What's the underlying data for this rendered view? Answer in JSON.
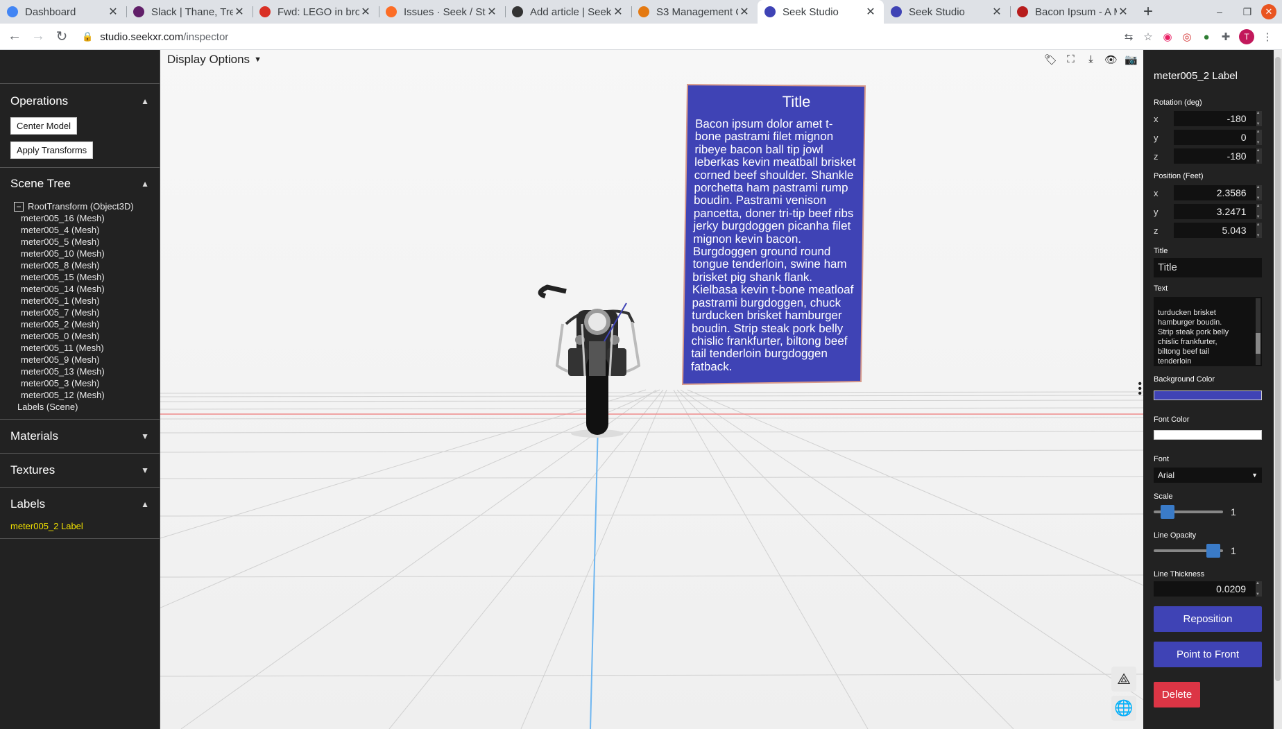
{
  "browser": {
    "tabs": [
      {
        "title": "Dashboard",
        "icon": "chrome-icon",
        "color": "#4285f4"
      },
      {
        "title": "Slack | Thane, Tre",
        "icon": "slack-icon",
        "color": "#611f69"
      },
      {
        "title": "Fwd: LEGO in bro",
        "icon": "gmail-icon",
        "color": "#d93025"
      },
      {
        "title": "Issues · Seek / Stu",
        "icon": "gitlab-icon",
        "color": "#fc6d26"
      },
      {
        "title": "Add article | Seek",
        "icon": "github-icon",
        "color": "#333333"
      },
      {
        "title": "S3 Management C",
        "icon": "aws-icon",
        "color": "#e47911"
      },
      {
        "title": "Seek Studio",
        "icon": "seek-icon",
        "color": "#3f43b5",
        "active": true
      },
      {
        "title": "Seek Studio",
        "icon": "seek-icon",
        "color": "#3f43b5"
      },
      {
        "title": "Bacon Ipsum - A M",
        "icon": "bacon-icon",
        "color": "#b71c1c"
      }
    ],
    "url_host": "studio.seekxr.com",
    "url_path": "/inspector",
    "avatar_letter": "T"
  },
  "left": {
    "operations": {
      "title": "Operations",
      "center_model": "Center Model",
      "apply_transforms": "Apply Transforms"
    },
    "scene_tree": {
      "title": "Scene Tree",
      "root": "RootTransform (Object3D)",
      "items": [
        "meter005_16 (Mesh)",
        "meter005_4 (Mesh)",
        "meter005_5 (Mesh)",
        "meter005_10 (Mesh)",
        "meter005_8 (Mesh)",
        "meter005_15 (Mesh)",
        "meter005_14 (Mesh)",
        "meter005_1 (Mesh)",
        "meter005_7 (Mesh)",
        "meter005_2 (Mesh)",
        "meter005_0 (Mesh)",
        "meter005_11 (Mesh)",
        "meter005_9 (Mesh)",
        "meter005_13 (Mesh)",
        "meter005_3 (Mesh)",
        "meter005_12 (Mesh)"
      ],
      "labels_node": "Labels (Scene)"
    },
    "materials": "Materials",
    "textures": "Textures",
    "labels": {
      "title": "Labels",
      "item": "meter005_2 Label"
    }
  },
  "viewport": {
    "display_options": "Display Options",
    "label_board": {
      "title": "Title",
      "text": "Bacon ipsum dolor amet t-bone pastrami filet mignon ribeye bacon ball tip jowl leberkas kevin meatball brisket corned beef shoulder. Shankle porchetta ham pastrami rump boudin. Pastrami venison pancetta, doner tri-tip beef ribs jerky burgdoggen picanha filet mignon kevin bacon. Burgdoggen ground round tongue tenderloin, swine ham brisket pig shank flank. Kielbasa kevin t-bone meatloaf pastrami burgdoggen, chuck turducken brisket hamburger boudin. Strip steak pork belly chislic frankfurter, biltong beef tail tenderloin burgdoggen fatback."
    }
  },
  "inspector": {
    "title": "meter005_2 Label",
    "rotation_label": "Rotation (deg)",
    "rotation": {
      "x": "-180",
      "y": "0",
      "z": "-180"
    },
    "position_label": "Position (Feet)",
    "position": {
      "x": "2.3586",
      "y": "3.2471",
      "z": "5.043"
    },
    "title_label": "Title",
    "title_value": "Title",
    "text_label": "Text",
    "text_value": "turducken brisket\nhamburger boudin.\nStrip steak pork belly\nchislic frankfurter,\nbiltong beef tail\ntenderloin\nburgdoggen fatback.",
    "bg_color_label": "Background Color",
    "bg_color": "#3f43b5",
    "font_color_label": "Font Color",
    "font_color": "#ffffff",
    "font_label": "Font",
    "font_value": "Arial",
    "scale_label": "Scale",
    "scale_value": "1",
    "scale_fraction": 0.12,
    "line_opacity_label": "Line Opacity",
    "line_opacity_value": "1",
    "line_opacity_fraction": 0.95,
    "line_thickness_label": "Line Thickness",
    "line_thickness_value": "0.0209",
    "reposition": "Reposition",
    "point_to_front": "Point to Front",
    "delete": "Delete"
  }
}
